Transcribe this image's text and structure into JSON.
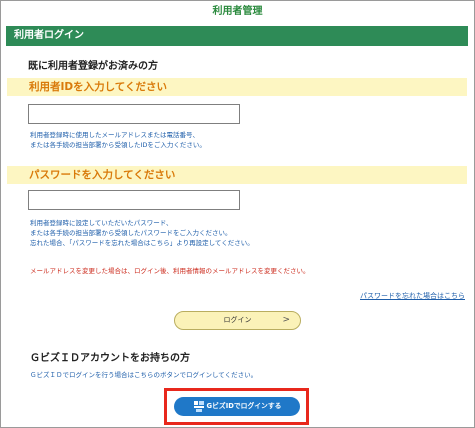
{
  "page": {
    "top_title": "利用者管理",
    "section_header": "利用者ログイン",
    "login_title": "既に利用者登録がお済みの方"
  },
  "user_id": {
    "label": "利用者IDを入力してください",
    "value": "",
    "help": "利用者登録時に使用したメールアドレスまたは電話番号、\nまたは各手続の担当部署から受領したIDをご入力ください。"
  },
  "password": {
    "label": "パスワードを入力してください",
    "value": "",
    "help": "利用者登録時に設定していただいたパスワード、\nまたは各手続の担当部署から受領したパスワードをご入力ください。\n忘れた場合、「パスワードを忘れた場合はこちら」より再設定してください。"
  },
  "warning": "メールアドレスを変更した場合は、ログイン後、利用者情報のメールアドレスを変更ください。",
  "forgot_link": "パスワードを忘れた場合はこちら",
  "login_button": {
    "label": "ログイン",
    "chevron": ">"
  },
  "gbiz": {
    "heading": "ＧビズＩＤアカウントをお持ちの方",
    "description": "ＧビズＩＤでログインを行う場合はこちらのボタンでログインしてください。",
    "button_label": "GビズIDでログインする",
    "button_icon": "gbizid-logo-icon"
  },
  "colors": {
    "header_green": "#2e8b57",
    "band_yellow": "#fdf6c2",
    "label_orange": "#d97a0a",
    "link_blue": "#1e5eaa",
    "warning_red": "#cc2b1d",
    "gbiz_blue": "#1f78c8",
    "highlight_red": "#e8281c"
  }
}
